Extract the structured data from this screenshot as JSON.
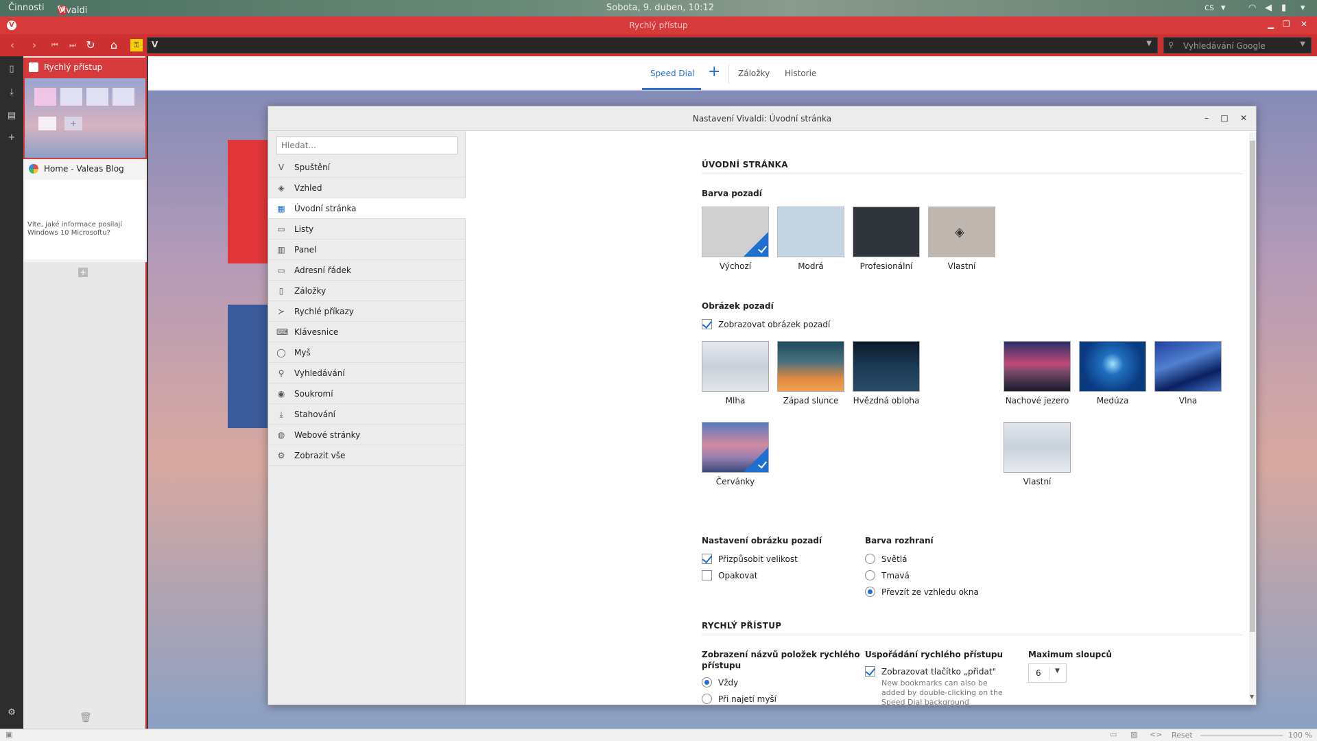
{
  "system": {
    "activities": "Činnosti",
    "app": "Vivaldi",
    "clock": "Sobota,  9. duben, 10:12",
    "lang": "cs"
  },
  "window": {
    "title": "Rychlý přístup"
  },
  "search": {
    "placeholder": "Vyhledávání Google"
  },
  "tabs": [
    {
      "title": "Rychlý přístup"
    },
    {
      "title": "Home - Valeas Blog",
      "preview_line1": "Víte, jaké informace posílají",
      "preview_line2": "Windows 10 Microsoftu?"
    }
  ],
  "speed_dial_nav": {
    "speed_dial": "Speed Dial",
    "bookmarks": "Záložky",
    "history": "Historie"
  },
  "dialog": {
    "title": "Nastavení Vivaldi: Úvodní stránka",
    "search_placeholder": "Hledat...",
    "sidebar": [
      {
        "label": "Spuštění",
        "icon": "vivaldi-icon"
      },
      {
        "label": "Vzhled",
        "icon": "paint-bucket-icon"
      },
      {
        "label": "Úvodní stránka",
        "icon": "grid-icon",
        "active": true
      },
      {
        "label": "Listy",
        "icon": "tabs-icon"
      },
      {
        "label": "Panel",
        "icon": "panel-icon"
      },
      {
        "label": "Adresní řádek",
        "icon": "address-bar-icon"
      },
      {
        "label": "Záložky",
        "icon": "bookmark-icon"
      },
      {
        "label": "Rychlé příkazy",
        "icon": "command-icon"
      },
      {
        "label": "Klávesnice",
        "icon": "keyboard-icon"
      },
      {
        "label": "Myš",
        "icon": "mouse-icon"
      },
      {
        "label": "Vyhledávání",
        "icon": "search-icon"
      },
      {
        "label": "Soukromí",
        "icon": "eye-icon"
      },
      {
        "label": "Stahování",
        "icon": "download-icon"
      },
      {
        "label": "Webové stránky",
        "icon": "globe-icon"
      },
      {
        "label": "Zobrazit vše",
        "icon": "gear-icon"
      }
    ],
    "section1_title": "ÚVODNÍ STRÁNKA",
    "bg_color": {
      "title": "Barva pozadí",
      "options": [
        {
          "label": "Výchozí",
          "color": "#d0d0d0",
          "selected": true
        },
        {
          "label": "Modrá",
          "color": "#c4d4e2"
        },
        {
          "label": "Profesionální",
          "color": "#2e3439"
        },
        {
          "label": "Vlastní",
          "color": "#c0b6b0"
        }
      ]
    },
    "bg_image": {
      "title": "Obrázek pozadí",
      "show_label": "Zobrazovat obrázek pozadí",
      "show_checked": true,
      "images": [
        {
          "label": "Mlha"
        },
        {
          "label": "Západ slunce"
        },
        {
          "label": "Hvězdná obloha"
        },
        {
          "label": "Nachové jezero"
        },
        {
          "label": "Medúza"
        },
        {
          "label": "Vlna"
        },
        {
          "label": "Červánky",
          "selected": true
        },
        {
          "label": "Vlastní"
        }
      ]
    },
    "image_settings": {
      "title": "Nastavení obrázku pozadí",
      "fit": "Přizpůsobit velikost",
      "fit_checked": true,
      "repeat": "Opakovat",
      "repeat_checked": false
    },
    "ui_color": {
      "title": "Barva rozhraní",
      "options": [
        {
          "label": "Světlá",
          "selected": false
        },
        {
          "label": "Tmavá",
          "selected": false
        },
        {
          "label": "Převzít ze vzhledu okna",
          "selected": true
        }
      ]
    },
    "section2_title": "RYCHLÝ PŘÍSTUP",
    "titles_display": {
      "title_line1": "Zobrazení názvů položek rychlého",
      "title_line2": "přístupu",
      "options": [
        {
          "label": "Vždy",
          "selected": true
        },
        {
          "label": "Při najetí myší",
          "selected": false
        }
      ]
    },
    "arrangement": {
      "title": "Uspořádání rychlého přístupu",
      "add_label": "Zobrazovat tlačítko „přidat\"",
      "add_checked": true,
      "hint_line1": "New bookmarks can also be",
      "hint_line2": "added by double-clicking on the",
      "hint_line3": "Speed Dial background"
    },
    "max_columns": {
      "title": "Maximum sloupců",
      "value": "6"
    }
  },
  "statusbar": {
    "reset": "Reset",
    "zoom": "100 %"
  }
}
